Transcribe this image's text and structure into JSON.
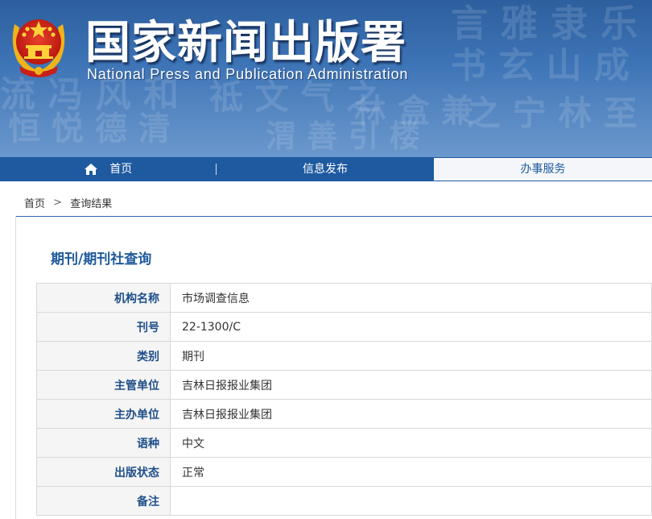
{
  "header": {
    "title": "国家新闻出版署",
    "subtitle": "National Press and Publication Administration"
  },
  "nav": {
    "home": "首页",
    "info": "信息发布",
    "service": "办事服务"
  },
  "breadcrumb": {
    "home": "首页",
    "separator": ">",
    "current": "查询结果"
  },
  "section_title": "期刊/期刊社查询",
  "details": [
    {
      "label": "机构名称",
      "value": "市场调查信息"
    },
    {
      "label": "刊号",
      "value": "22-1300/C"
    },
    {
      "label": "类别",
      "value": "期刊"
    },
    {
      "label": "主管单位",
      "value": "吉林日报报业集团"
    },
    {
      "label": "主办单位",
      "value": "吉林日报报业集团"
    },
    {
      "label": "语种",
      "value": "中文"
    },
    {
      "label": "出版状态",
      "value": "正常"
    },
    {
      "label": "备注",
      "value": ""
    }
  ],
  "colors": {
    "nav_bg": "#1f5aa0",
    "label_text": "#1f4f8a",
    "title_text": "#1f5a9b"
  }
}
